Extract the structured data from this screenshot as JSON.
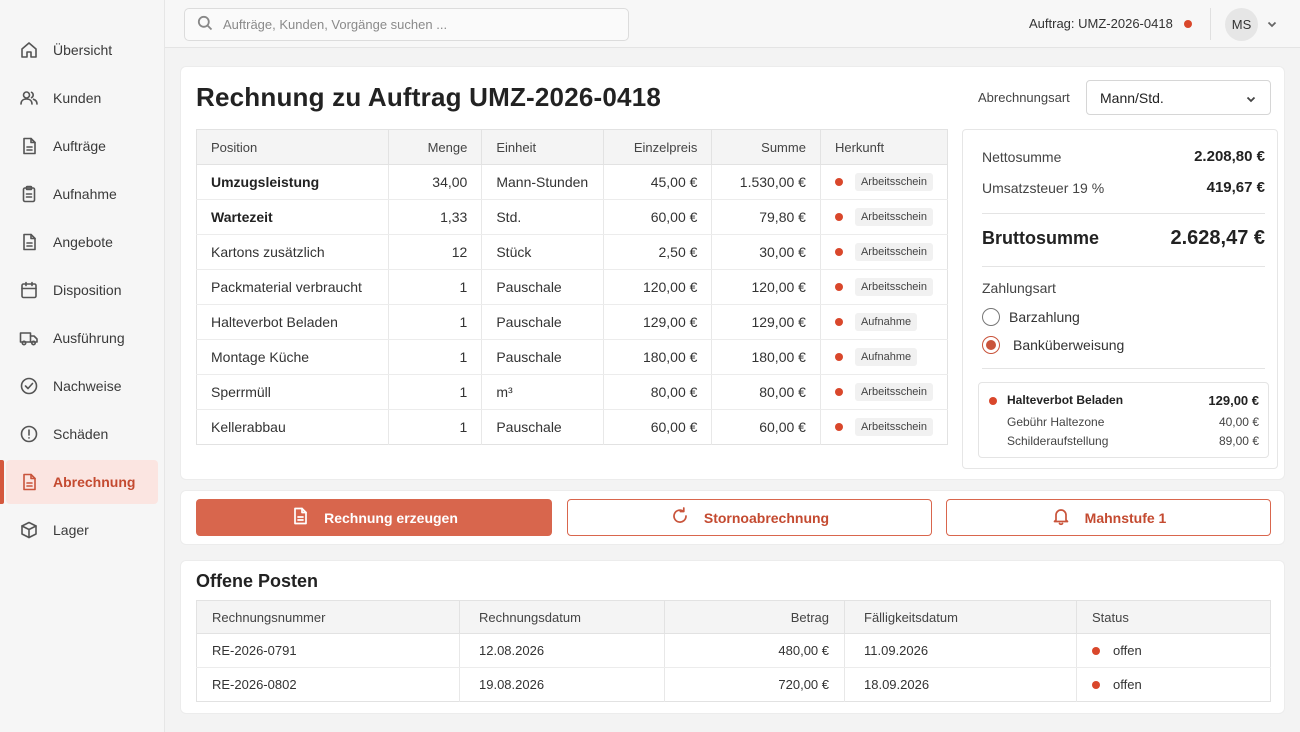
{
  "sidebar": {
    "items": [
      {
        "label": "Übersicht",
        "icon": "home-icon"
      },
      {
        "label": "Kunden",
        "icon": "users-icon"
      },
      {
        "label": "Aufträge",
        "icon": "document-icon"
      },
      {
        "label": "Aufnahme",
        "icon": "clipboard-icon"
      },
      {
        "label": "Angebote",
        "icon": "document-icon"
      },
      {
        "label": "Disposition",
        "icon": "calendar-icon"
      },
      {
        "label": "Ausführung",
        "icon": "truck-icon"
      },
      {
        "label": "Nachweise",
        "icon": "check-circle-icon"
      },
      {
        "label": "Schäden",
        "icon": "alert-circle-icon"
      },
      {
        "label": "Abrechnung",
        "icon": "document-icon",
        "active": true
      },
      {
        "label": "Lager",
        "icon": "box-icon"
      }
    ]
  },
  "topbar": {
    "search_placeholder": "Aufträge, Kunden, Vorgänge suchen ...",
    "order_ref": "Auftrag: UMZ-2026-0418",
    "avatar_initials": "MS"
  },
  "main": {
    "title": "Rechnung zu Auftrag UMZ-2026-0418",
    "billing_label": "Abrechnungsart",
    "billing_value": "Mann/Std.",
    "table": {
      "headers": [
        "Position",
        "Menge",
        "Einheit",
        "Einzelpreis",
        "Summe",
        "Herkunft"
      ],
      "rows": [
        {
          "position": "Umzugsleistung",
          "menge": "34,00",
          "einheit": "Mann-Stunden",
          "einzelpreis": "45,00 €",
          "summe": "1.530,00 €",
          "herkunft": "Arbeitsschein",
          "bold": true
        },
        {
          "position": "Wartezeit",
          "menge": "1,33",
          "einheit": "Std.",
          "einzelpreis": "60,00 €",
          "summe": "79,80 €",
          "herkunft": "Arbeitsschein",
          "bold": true
        },
        {
          "position": "Kartons zusätzlich",
          "menge": "12",
          "einheit": "Stück",
          "einzelpreis": "2,50 €",
          "summe": "30,00 €",
          "herkunft": "Arbeitsschein"
        },
        {
          "position": "Packmaterial verbraucht",
          "menge": "1",
          "einheit": "Pauschale",
          "einzelpreis": "120,00 €",
          "summe": "120,00 €",
          "herkunft": "Arbeitsschein"
        },
        {
          "position": "Halteverbot Beladen",
          "menge": "1",
          "einheit": "Pauschale",
          "einzelpreis": "129,00 €",
          "summe": "129,00 €",
          "herkunft": "Aufnahme"
        },
        {
          "position": "Montage Küche",
          "menge": "1",
          "einheit": "Pauschale",
          "einzelpreis": "180,00 €",
          "summe": "180,00 €",
          "herkunft": "Aufnahme"
        },
        {
          "position": "Sperrmüll",
          "menge": "1",
          "einheit": "m³",
          "einzelpreis": "80,00 €",
          "summe": "80,00 €",
          "herkunft": "Arbeitsschein"
        },
        {
          "position": "Kellerabbau",
          "menge": "1",
          "einheit": "Pauschale",
          "einzelpreis": "60,00 €",
          "summe": "60,00 €",
          "herkunft": "Arbeitsschein"
        }
      ]
    }
  },
  "summary": {
    "net_label": "Nettosumme",
    "net_value": "2.208,80 €",
    "vat_label": "Umsatzsteuer 19 %",
    "vat_value": "419,67 €",
    "gross_label": "Bruttosumme",
    "gross_value": "2.628,47 €",
    "payment_title": "Zahlungsart",
    "payment_options": [
      {
        "label": "Barzahlung",
        "selected": false
      },
      {
        "label": "Banküberweisung",
        "selected": true
      }
    ],
    "detail": {
      "title": "Halteverbot Beladen",
      "total": "129,00 €",
      "lines": [
        {
          "label": "Gebühr Haltezone",
          "value": "40,00 €"
        },
        {
          "label": "Schilderaufstellung",
          "value": "89,00 €"
        }
      ]
    }
  },
  "actions": {
    "create_invoice": "Rechnung erzeugen",
    "cancel_invoice": "Stornoabrechnung",
    "dunning": "Mahnstufe 1"
  },
  "open_items": {
    "title": "Offene Posten",
    "headers": [
      "Rechnungsnummer",
      "Rechnungsdatum",
      "Betrag",
      "Fälligkeitsdatum",
      "Status"
    ],
    "rows": [
      {
        "number": "RE-2026-0791",
        "date": "12.08.2026",
        "amount": "480,00 €",
        "due": "11.09.2026",
        "status": "offen"
      },
      {
        "number": "RE-2026-0802",
        "date": "19.08.2026",
        "amount": "720,00 €",
        "due": "18.09.2026",
        "status": "offen"
      }
    ]
  },
  "colors": {
    "accent": "#d8664d",
    "status_dot": "#d9472b",
    "active_bg": "#fbe5e1"
  }
}
